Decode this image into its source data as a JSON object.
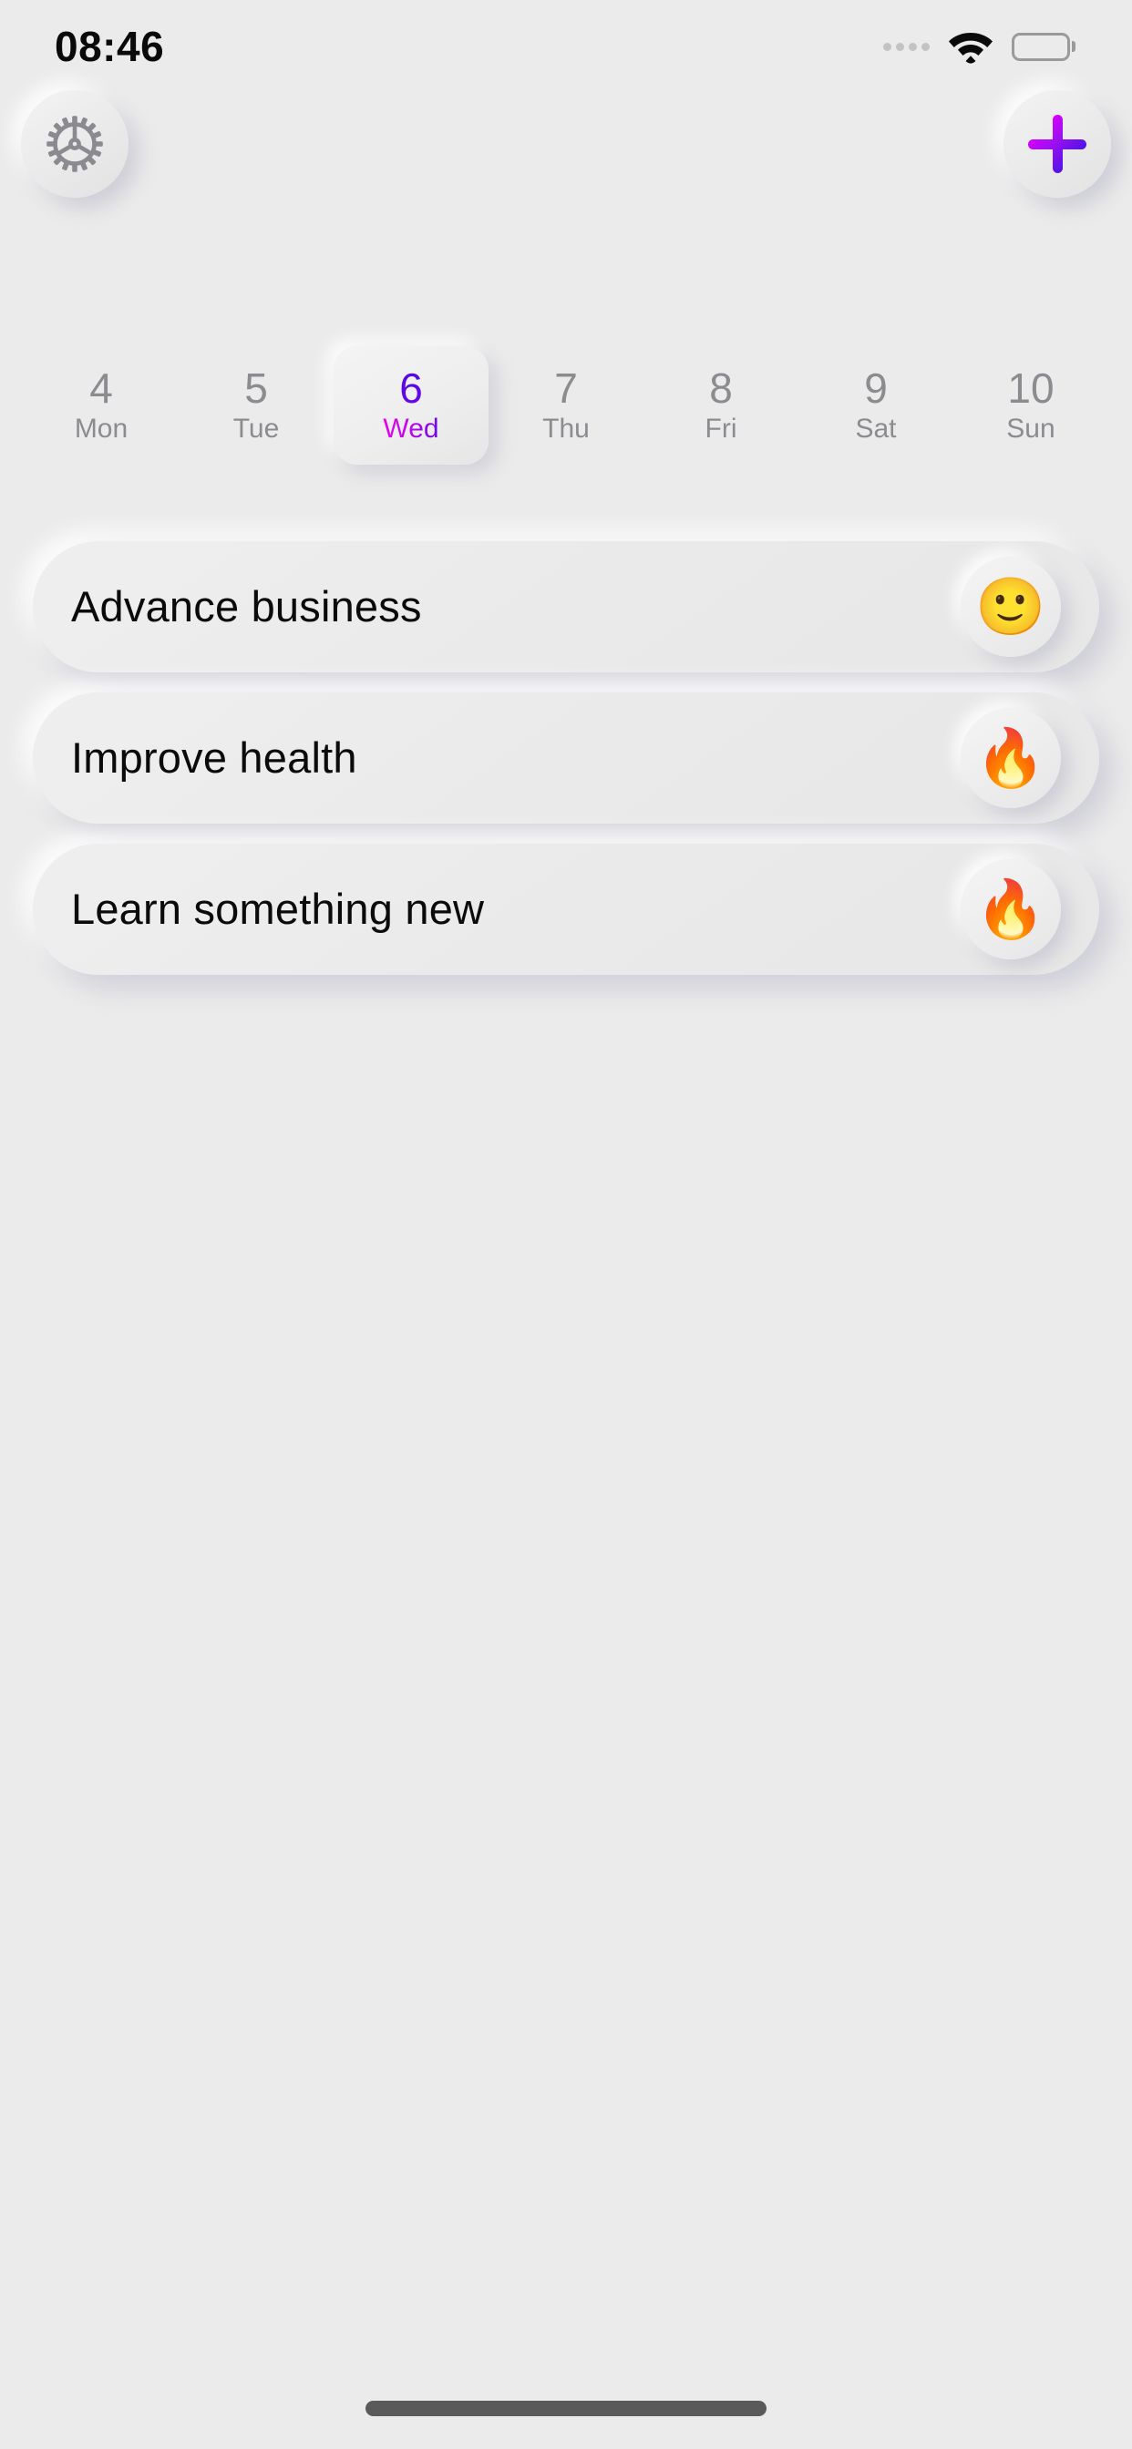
{
  "status_bar": {
    "time": "08:46",
    "signal_icon": "signal-dots-icon",
    "wifi_icon": "wifi-icon",
    "battery_icon": "battery-icon"
  },
  "header": {
    "settings_icon": "gear-icon",
    "add_icon": "plus-icon",
    "accent_start": "#d900ff",
    "accent_end": "#4b12e8"
  },
  "week_strip": {
    "selected_index": 2,
    "days": [
      {
        "num": "4",
        "dow": "Mon",
        "selected": false
      },
      {
        "num": "5",
        "dow": "Tue",
        "selected": false
      },
      {
        "num": "6",
        "dow": "Wed",
        "selected": true
      },
      {
        "num": "7",
        "dow": "Thu",
        "selected": false
      },
      {
        "num": "8",
        "dow": "Fri",
        "selected": false
      },
      {
        "num": "9",
        "dow": "Sat",
        "selected": false
      },
      {
        "num": "10",
        "dow": "Sun",
        "selected": false
      }
    ]
  },
  "habits": [
    {
      "title": "Advance business",
      "emoji": "🙂",
      "emoji_name": "slightly-smiling-face-icon"
    },
    {
      "title": "Improve health",
      "emoji": "🔥",
      "emoji_name": "fire-icon"
    },
    {
      "title": "Learn something new",
      "emoji": "🔥",
      "emoji_name": "fire-icon"
    }
  ],
  "colors": {
    "background": "#ebebeb",
    "card": "#eaeaea",
    "text_primary": "#0b0b0b",
    "text_muted": "#8b8b90",
    "accent_purple": "#5108e6",
    "accent_magenta": "#ec00ec"
  }
}
